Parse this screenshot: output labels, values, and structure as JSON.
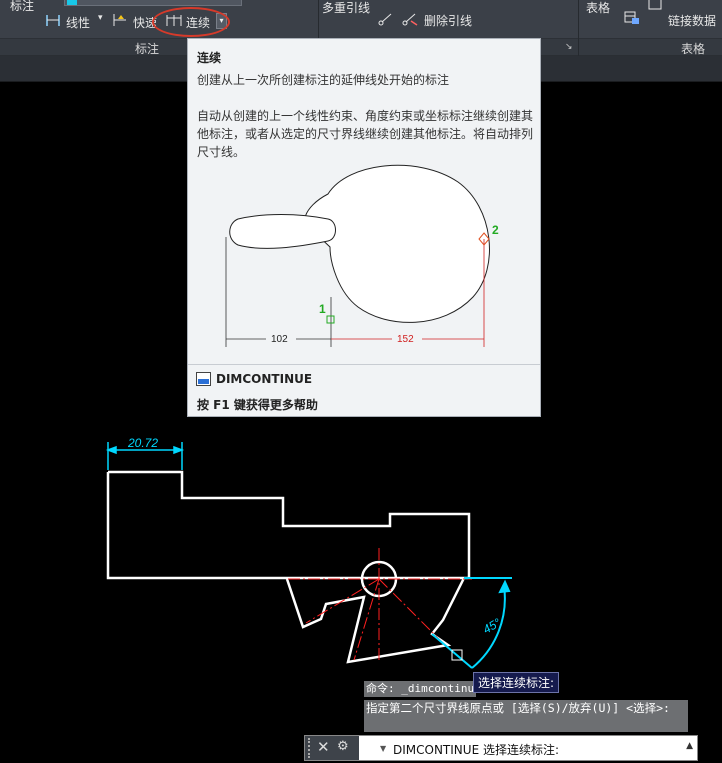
{
  "ribbon": {
    "dim_label_top": "标注",
    "linear_label": "线性",
    "quick_label": "快速",
    "continue_label": "连续",
    "panel_title_dimension": "标注",
    "multileader_label": "多重引线",
    "remove_leader_label": "删除引线",
    "table_label": "表格",
    "link_data_label": "链接数据",
    "panel_title_table": "表格"
  },
  "tooltip": {
    "title": "连续",
    "description": "创建从上一次所创建标注的延伸线处开始的标注",
    "detail": "自动从创建的上一个线性约束、角度约束或坐标标注继续创建其他标注，或者从选定的尺寸界线继续创建其他标注。将自动排列尺寸线。",
    "illus_dim_left": "102",
    "illus_dim_right": "152",
    "illus_point1": "1",
    "illus_point2": "2",
    "command": "DIMCONTINUE",
    "help": "按 F1 键获得更多帮助"
  },
  "drawing": {
    "dim_value": "20.72",
    "angle_value": "45°"
  },
  "command": {
    "hint": "选择连续标注:",
    "history1": "命令: _dimcontinue",
    "history2": "指定第二个尺寸界线原点或 [选择(S)/放弃(U)] <选择>:",
    "current": "DIMCONTINUE 选择连续标注:"
  },
  "colors": {
    "background": "#000000",
    "geometry": "#ffffff",
    "dimension": "#00d8ff",
    "centerline": "#ff2020",
    "ribbon": "#3b4048",
    "highlight_ellipse": "#d63a2a"
  }
}
